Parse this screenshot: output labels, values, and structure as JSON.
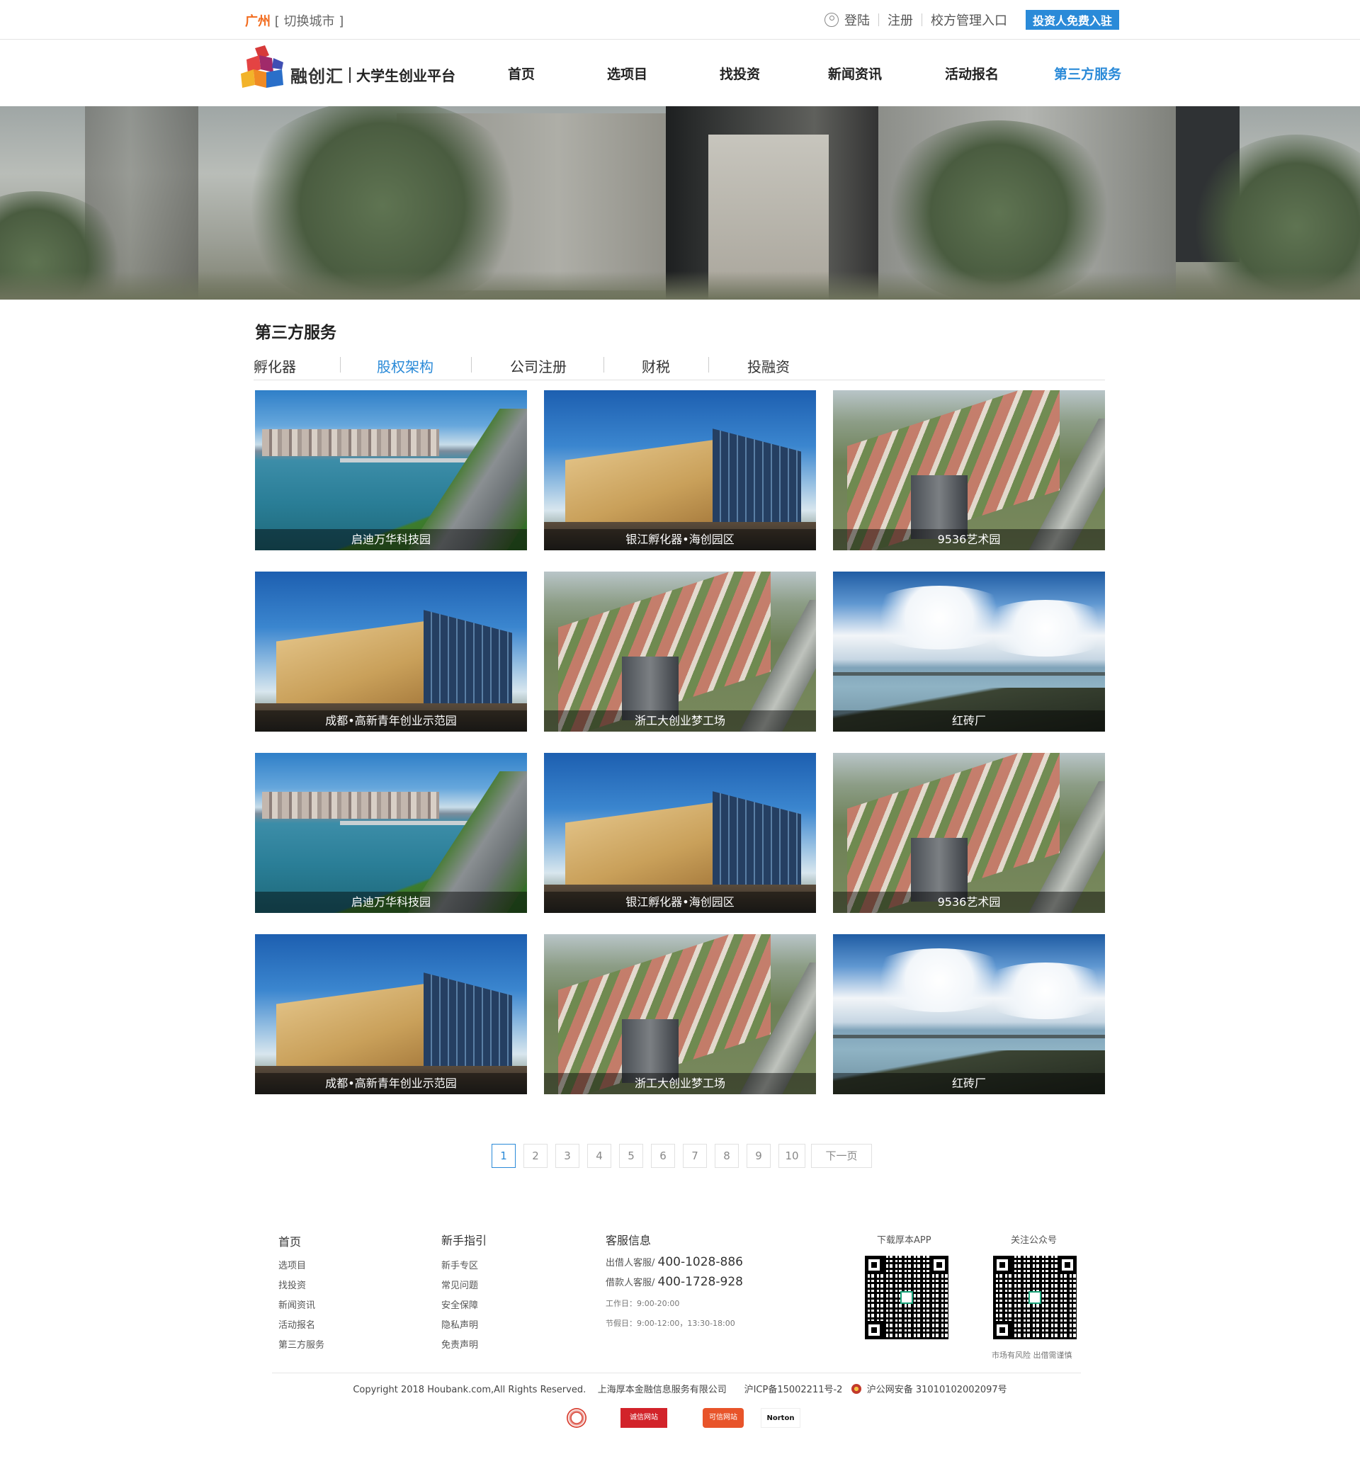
{
  "topbar": {
    "city": "广州",
    "switch_city": "[ 切换城市 ]",
    "login": "登陆",
    "register": "注册",
    "school_admin": "校方管理入口",
    "investor_join": "投资人免费入驻",
    "user_icon": "user-icon"
  },
  "header": {
    "logo_brand": "融创汇",
    "logo_sub": "大学生创业平台",
    "nav": [
      "首页",
      "选项目",
      "找投资",
      "新闻资讯",
      "活动报名",
      "第三方服务"
    ],
    "active_nav": "第三方服务"
  },
  "section": {
    "title": "第三方服务",
    "tabs": [
      "孵化器",
      "股权架构",
      "公司注册",
      "财税",
      "投融资"
    ],
    "active_tab": "股权架构"
  },
  "cards": [
    {
      "caption": "启迪万华科技园",
      "image": "lake"
    },
    {
      "caption": "银江孵化器•海创园区",
      "image": "building"
    },
    {
      "caption": "9536艺术园",
      "image": "campus"
    },
    {
      "caption": "成都•高新青年创业示范园",
      "image": "building"
    },
    {
      "caption": "浙工大创业梦工场",
      "image": "campus"
    },
    {
      "caption": "红砖厂",
      "image": "sea"
    },
    {
      "caption": "启迪万华科技园",
      "image": "lake"
    },
    {
      "caption": "银江孵化器•海创园区",
      "image": "building"
    },
    {
      "caption": "9536艺术园",
      "image": "campus"
    },
    {
      "caption": "成都•高新青年创业示范园",
      "image": "building"
    },
    {
      "caption": "浙工大创业梦工场",
      "image": "campus"
    },
    {
      "caption": "红砖厂",
      "image": "sea"
    }
  ],
  "pagination": {
    "pages": [
      "1",
      "2",
      "3",
      "4",
      "5",
      "6",
      "7",
      "8",
      "9",
      "10"
    ],
    "current": "1",
    "next": "下一页"
  },
  "footer": {
    "col1_title": "首页",
    "col1_links": [
      "选项目",
      "找投资",
      "新闻资讯",
      "活动报名",
      "第三方服务"
    ],
    "col2_title": "新手指引",
    "col2_links": [
      "新手专区",
      "常见问题",
      "安全保障",
      "隐私声明",
      "免责声明"
    ],
    "col3_title": "客服信息",
    "lender_label": "出借人客服/",
    "lender_phone": "400-1028-886",
    "borrower_label": "借款人客服/",
    "borrower_phone": "400-1728-928",
    "workday": "工作日：9:00-20:00",
    "holiday": "节假日：9:00-12:00，13:30-18:00",
    "app_title": "下载厚本APP",
    "wechat_title": "关注公众号",
    "risk_note": "市场有风险 出借需谨慎",
    "copyright": "Copyright 2018 Houbank.com,All Rights Reserved.",
    "company": "上海厚本金融信息服务有限公司",
    "icp": "沪ICP备15002211号-2",
    "police": "沪公网安备 31010102002097号",
    "badges": [
      "诚信网站",
      "可信网站",
      "Norton"
    ]
  },
  "colors": {
    "accent": "#2a8ad8",
    "city": "#f26b1d"
  }
}
